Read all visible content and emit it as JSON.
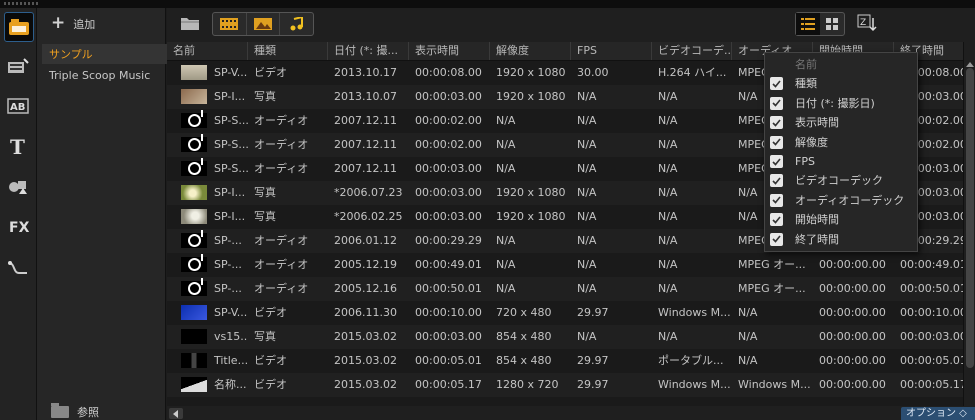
{
  "toolbar": [
    "media-library-icon",
    "instant-project-icon",
    "title-icon",
    "text-icon",
    "graphics-icon",
    "fx-icon",
    "path-icon"
  ],
  "library": {
    "add_label": "追加",
    "items": [
      "サンプル",
      "Triple Scoop Music"
    ],
    "browse_label": "参照"
  },
  "table": {
    "columns": [
      "名前",
      "種類",
      "日付 (*: 撮...",
      "表示時間",
      "解像度",
      "FPS",
      "ビデオコーデ...",
      "オーディオ...",
      "開始時間",
      "終了時間"
    ],
    "rows": [
      {
        "name": "SP-V...",
        "type": "ビデオ",
        "date": "2013.10.17",
        "duration": "00:00:08.00",
        "res": "1920 x 1080",
        "fps": "30.00",
        "vcodec": "H.264 ハイ...",
        "acodec": "MPEG",
        "start": "00:00:00.00",
        "end": "00:00:08.00"
      },
      {
        "name": "SP-I...",
        "type": "写真",
        "date": "2013.10.07",
        "duration": "00:00:03.00",
        "res": "1920 x 1080",
        "fps": "N/A",
        "vcodec": "N/A",
        "acodec": "N/A",
        "start": "00:00:00.00",
        "end": "00:00:03.00"
      },
      {
        "name": "SP-S...",
        "type": "オーディオ",
        "date": "2007.12.11",
        "duration": "00:00:02.00",
        "res": "N/A",
        "fps": "N/A",
        "vcodec": "N/A",
        "acodec": "MPEG",
        "start": "00:00:00.00",
        "end": "00:00:02.00"
      },
      {
        "name": "SP-S...",
        "type": "オーディオ",
        "date": "2007.12.11",
        "duration": "00:00:02.00",
        "res": "N/A",
        "fps": "N/A",
        "vcodec": "N/A",
        "acodec": "MPEG",
        "start": "00:00:00.00",
        "end": "00:00:02.00"
      },
      {
        "name": "SP-S...",
        "type": "オーディオ",
        "date": "2007.12.11",
        "duration": "00:00:03.00",
        "res": "N/A",
        "fps": "N/A",
        "vcodec": "N/A",
        "acodec": "MPEG",
        "start": "00:00:00.00",
        "end": "00:00:03.00"
      },
      {
        "name": "SP-I...",
        "type": "写真",
        "date": "*2006.07.23",
        "duration": "00:00:03.00",
        "res": "1920 x 1080",
        "fps": "N/A",
        "vcodec": "N/A",
        "acodec": "N/A",
        "start": "00:00:00.00",
        "end": "00:00:03.00"
      },
      {
        "name": "SP-I...",
        "type": "写真",
        "date": "*2006.02.25",
        "duration": "00:00:03.00",
        "res": "1920 x 1080",
        "fps": "N/A",
        "vcodec": "N/A",
        "acodec": "N/A",
        "start": "00:00:00.00",
        "end": "00:00:03.00"
      },
      {
        "name": "SP-...",
        "type": "オーディオ",
        "date": "2006.01.12",
        "duration": "00:00:29.29",
        "res": "N/A",
        "fps": "N/A",
        "vcodec": "N/A",
        "acodec": "MPEG",
        "start": "00:00:00.00",
        "end": "00:00:29.29"
      },
      {
        "name": "SP-...",
        "type": "オーディオ",
        "date": "2005.12.19",
        "duration": "00:00:49.01",
        "res": "N/A",
        "fps": "N/A",
        "vcodec": "N/A",
        "acodec": "MPEG オー...",
        "start": "00:00:00.00",
        "end": "00:00:49.01"
      },
      {
        "name": "SP-...",
        "type": "オーディオ",
        "date": "2005.12.16",
        "duration": "00:00:50.01",
        "res": "N/A",
        "fps": "N/A",
        "vcodec": "N/A",
        "acodec": "MPEG オー...",
        "start": "00:00:00.00",
        "end": "00:00:50.01"
      },
      {
        "name": "SP-V...",
        "type": "ビデオ",
        "date": "2006.11.30",
        "duration": "00:00:10.00",
        "res": "720 x 480",
        "fps": "29.97",
        "vcodec": "Windows M...",
        "acodec": "N/A",
        "start": "00:00:00.00",
        "end": "00:00:10.00"
      },
      {
        "name": "vs15...",
        "type": "写真",
        "date": "2015.03.02",
        "duration": "00:00:03.00",
        "res": "854 x 480",
        "fps": "N/A",
        "vcodec": "N/A",
        "acodec": "N/A",
        "start": "00:00:00.00",
        "end": "00:00:03.00"
      },
      {
        "name": "Title...",
        "type": "ビデオ",
        "date": "2015.03.02",
        "duration": "00:00:05.01",
        "res": "854 x 480",
        "fps": "29.97",
        "vcodec": "ポータブル...",
        "acodec": "N/A",
        "start": "00:00:00.00",
        "end": "00:00:05.01"
      },
      {
        "name": "名称...",
        "type": "ビデオ",
        "date": "2015.03.02",
        "duration": "00:00:05.17",
        "res": "1280 x 720",
        "fps": "29.97",
        "vcodec": "Windows M...",
        "acodec": "Windows M...",
        "start": "00:00:00.00",
        "end": "00:00:05.17"
      }
    ],
    "thumbs": [
      "t-video",
      "t-photo1",
      "t-audio",
      "t-audio",
      "t-audio",
      "t-photo2",
      "t-photo3",
      "t-audio",
      "t-audio",
      "t-audio",
      "t-blue",
      "t-dark",
      "t-title",
      "t-curve"
    ]
  },
  "menu": {
    "items": [
      {
        "label": "名前",
        "checked": false,
        "disabled": true
      },
      {
        "label": "種類",
        "checked": true
      },
      {
        "label": "日付 (*: 撮影日)",
        "checked": true
      },
      {
        "label": "表示時間",
        "checked": true
      },
      {
        "label": "解像度",
        "checked": true
      },
      {
        "label": "FPS",
        "checked": true
      },
      {
        "label": "ビデオコーデック",
        "checked": true
      },
      {
        "label": "オーディオコーデック",
        "checked": true
      },
      {
        "label": "開始時間",
        "checked": true
      },
      {
        "label": "終了時間",
        "checked": true
      }
    ]
  },
  "options_label": "オプション ◇",
  "colors": {
    "accent": "#f0a020",
    "selection_border": "#2d5e8c",
    "options_bg": "#2b4e72"
  }
}
